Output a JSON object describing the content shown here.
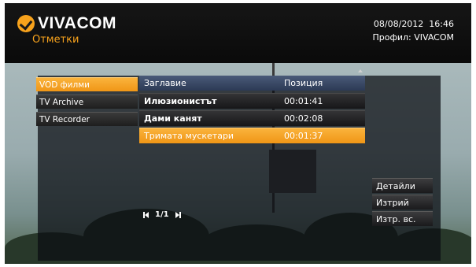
{
  "header": {
    "logo_text": "VIVACOM",
    "page_title": "Отметки",
    "datetime": "08/08/2012  16:46",
    "profile": "Профил: VIVACOM"
  },
  "sidebar": {
    "items": [
      {
        "label": "VOD филми",
        "active": true
      },
      {
        "label": "TV Archive",
        "active": false
      },
      {
        "label": "TV Recorder",
        "active": false
      }
    ]
  },
  "table": {
    "columns": [
      "Заглавие",
      "Позиция"
    ],
    "rows": [
      {
        "title": "Илюзионистът",
        "position": "00:01:41",
        "active": false
      },
      {
        "title": "Дами канят",
        "position": "00:02:08",
        "active": false
      },
      {
        "title": "Тримата мускетари",
        "position": "00:01:37",
        "active": true
      }
    ]
  },
  "pager": {
    "text": "1/1"
  },
  "actions": {
    "details": "Детайли",
    "delete": "Изтрий",
    "delete_all": "Изтр. вс."
  },
  "colors": {
    "accent": "#f7a21c",
    "header_bar": "#2c3a55"
  },
  "icons": [
    "vivacom-logo-icon",
    "scroll-up-icon",
    "prev-page-icon",
    "next-page-icon"
  ]
}
